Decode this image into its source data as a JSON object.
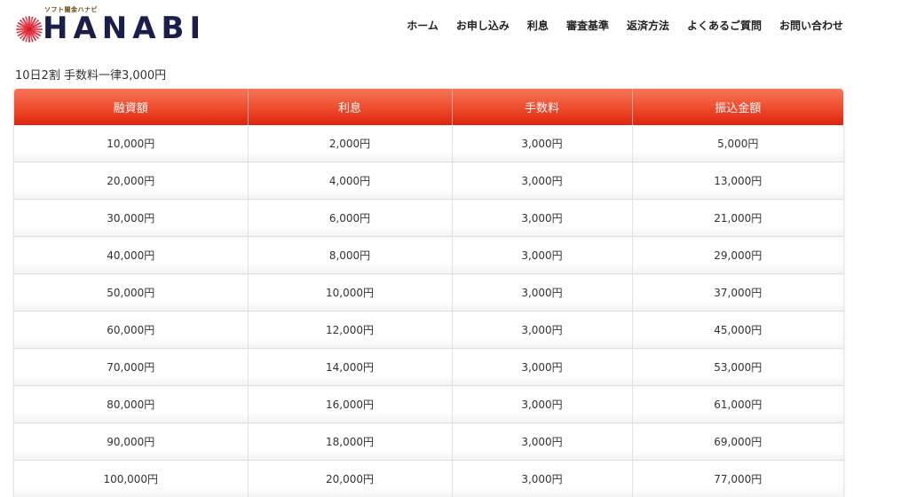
{
  "header": {
    "logo_tagline": "ソフト闇金ハナビ",
    "logo_text": "HANABI",
    "logo_icon": "firework-icon",
    "brand_color": "#1a1e4a",
    "nav": [
      {
        "label": "ホーム",
        "name": "nav-home"
      },
      {
        "label": "お申し込み",
        "name": "nav-apply"
      },
      {
        "label": "利息",
        "name": "nav-interest"
      },
      {
        "label": "審査基準",
        "name": "nav-screening"
      },
      {
        "label": "返済方法",
        "name": "nav-repayment"
      },
      {
        "label": "よくあるご質問",
        "name": "nav-faq"
      },
      {
        "label": "お問い合わせ",
        "name": "nav-contact"
      }
    ]
  },
  "caption": "10日2割 手数料一律3,000円",
  "table": {
    "header_color": "#ee4a2c",
    "columns": [
      "融資額",
      "利息",
      "手数料",
      "振込金額"
    ],
    "rows": [
      [
        "10,000円",
        "2,000円",
        "3,000円",
        "5,000円"
      ],
      [
        "20,000円",
        "4,000円",
        "3,000円",
        "13,000円"
      ],
      [
        "30,000円",
        "6,000円",
        "3,000円",
        "21,000円"
      ],
      [
        "40,000円",
        "8,000円",
        "3,000円",
        "29,000円"
      ],
      [
        "50,000円",
        "10,000円",
        "3,000円",
        "37,000円"
      ],
      [
        "60,000円",
        "12,000円",
        "3,000円",
        "45,000円"
      ],
      [
        "70,000円",
        "14,000円",
        "3,000円",
        "53,000円"
      ],
      [
        "80,000円",
        "16,000円",
        "3,000円",
        "61,000円"
      ],
      [
        "90,000円",
        "18,000円",
        "3,000円",
        "69,000円"
      ],
      [
        "100,000円",
        "20,000円",
        "3,000円",
        "77,000円"
      ]
    ]
  }
}
